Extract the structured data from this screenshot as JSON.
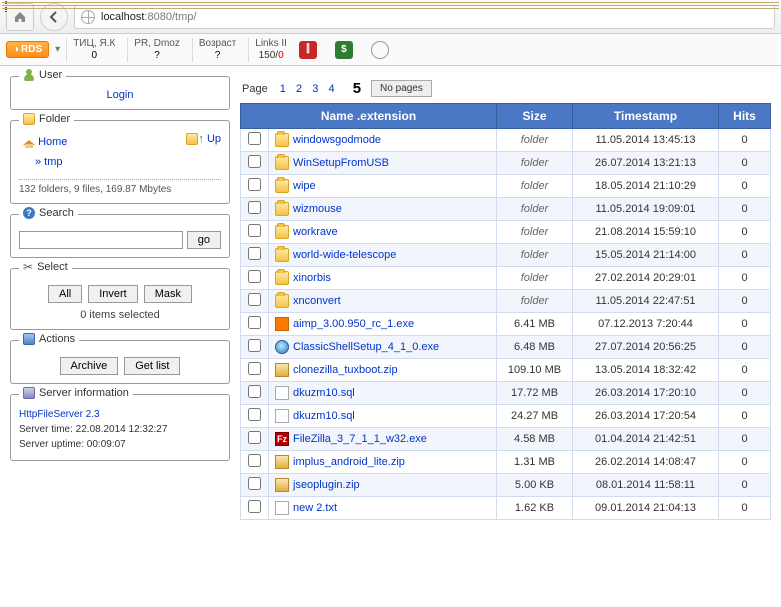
{
  "browser": {
    "url_host": "localhost",
    "url_port": ":8080",
    "url_path": "/tmp/"
  },
  "rds": {
    "badge": "RDS",
    "cells": [
      {
        "top": "ТИЦ, Я.К",
        "bot": "0"
      },
      {
        "top": "PR, Dmoz",
        "bot": "?"
      },
      {
        "top": "Возраст",
        "bot": "?"
      },
      {
        "top": "Links II",
        "bot_a": "150/",
        "bot_b": "0"
      }
    ]
  },
  "sidebar": {
    "user": {
      "title": "User",
      "login": "Login"
    },
    "folder": {
      "title": "Folder",
      "up": "Up",
      "home": "Home",
      "tmp": "» tmp",
      "stats": "132 folders, 9 files, 169.87 Mbytes"
    },
    "search": {
      "title": "Search",
      "go": "go",
      "placeholder": ""
    },
    "select": {
      "title": "Select",
      "all": "All",
      "invert": "Invert",
      "mask": "Mask",
      "status": "0 items selected"
    },
    "actions": {
      "title": "Actions",
      "archive": "Archive",
      "getlist": "Get list"
    },
    "server": {
      "title": "Server information",
      "app": "HttpFileServer 2.3",
      "time": "Server time: 22.08.2014 12:32:27",
      "uptime": "Server uptime: 00:09:07"
    }
  },
  "pager": {
    "label": "Page",
    "pages": [
      "1",
      "2",
      "3",
      "4"
    ],
    "current": "5",
    "nopages": "No pages"
  },
  "table": {
    "headers": {
      "name": "Name .extension",
      "size": "Size",
      "ts": "Timestamp",
      "hits": "Hits"
    },
    "rows": [
      {
        "icon": "folder",
        "name": "windowsgodmode",
        "size": "folder",
        "size_folder": true,
        "ts": "11.05.2014 13:45:13",
        "hits": "0"
      },
      {
        "icon": "folder",
        "name": "WinSetupFromUSB",
        "size": "folder",
        "size_folder": true,
        "ts": "26.07.2014 13:21:13",
        "hits": "0"
      },
      {
        "icon": "folder",
        "name": "wipe",
        "size": "folder",
        "size_folder": true,
        "ts": "18.05.2014 21:10:29",
        "hits": "0"
      },
      {
        "icon": "folder",
        "name": "wizmouse",
        "size": "folder",
        "size_folder": true,
        "ts": "11.05.2014 19:09:01",
        "hits": "0"
      },
      {
        "icon": "folder",
        "name": "workrave",
        "size": "folder",
        "size_folder": true,
        "ts": "21.08.2014 15:59:10",
        "hits": "0"
      },
      {
        "icon": "folder",
        "name": "world-wide-telescope",
        "size": "folder",
        "size_folder": true,
        "ts": "15.05.2014 21:14:00",
        "hits": "0"
      },
      {
        "icon": "folder",
        "name": "xinorbis",
        "size": "folder",
        "size_folder": true,
        "ts": "27.02.2014 20:29:01",
        "hits": "0"
      },
      {
        "icon": "folder",
        "name": "xnconvert",
        "size": "folder",
        "size_folder": true,
        "ts": "11.05.2014 22:47:51",
        "hits": "0"
      },
      {
        "icon": "orange",
        "name": "aimp_3.00.950_rc_1.exe",
        "size": "6.41 MB",
        "ts": "07.12.2013 7:20:44",
        "hits": "0"
      },
      {
        "icon": "shell",
        "name": "ClassicShellSetup_4_1_0.exe",
        "size": "6.48 MB",
        "ts": "27.07.2014 20:56:25",
        "hits": "0"
      },
      {
        "icon": "zip",
        "name": "clonezilla_tuxboot.zip",
        "size": "109.10 MB",
        "ts": "13.05.2014 18:32:42",
        "hits": "0"
      },
      {
        "icon": "sql",
        "name": "dkuzm10.sql",
        "size": "17.72 MB",
        "ts": "26.03.2014 17:20:10",
        "hits": "0"
      },
      {
        "icon": "sql",
        "name": "dkuzm10.sql",
        "size": "24.27 MB",
        "ts": "26.03.2014 17:20:54",
        "hits": "0"
      },
      {
        "icon": "fz",
        "name": "FileZilla_3_7_1_1_w32.exe",
        "size": "4.58 MB",
        "ts": "01.04.2014 21:42:51",
        "hits": "0"
      },
      {
        "icon": "zip",
        "name": "implus_android_lite.zip",
        "size": "1.31 MB",
        "ts": "26.02.2014 14:08:47",
        "hits": "0"
      },
      {
        "icon": "zip",
        "name": "jseoplugin.zip",
        "size": "5.00 KB",
        "ts": "08.01.2014 11:58:11",
        "hits": "0"
      },
      {
        "icon": "txt",
        "name": "new 2.txt",
        "size": "1.62 KB",
        "ts": "09.01.2014 21:04:13",
        "hits": "0"
      }
    ]
  }
}
